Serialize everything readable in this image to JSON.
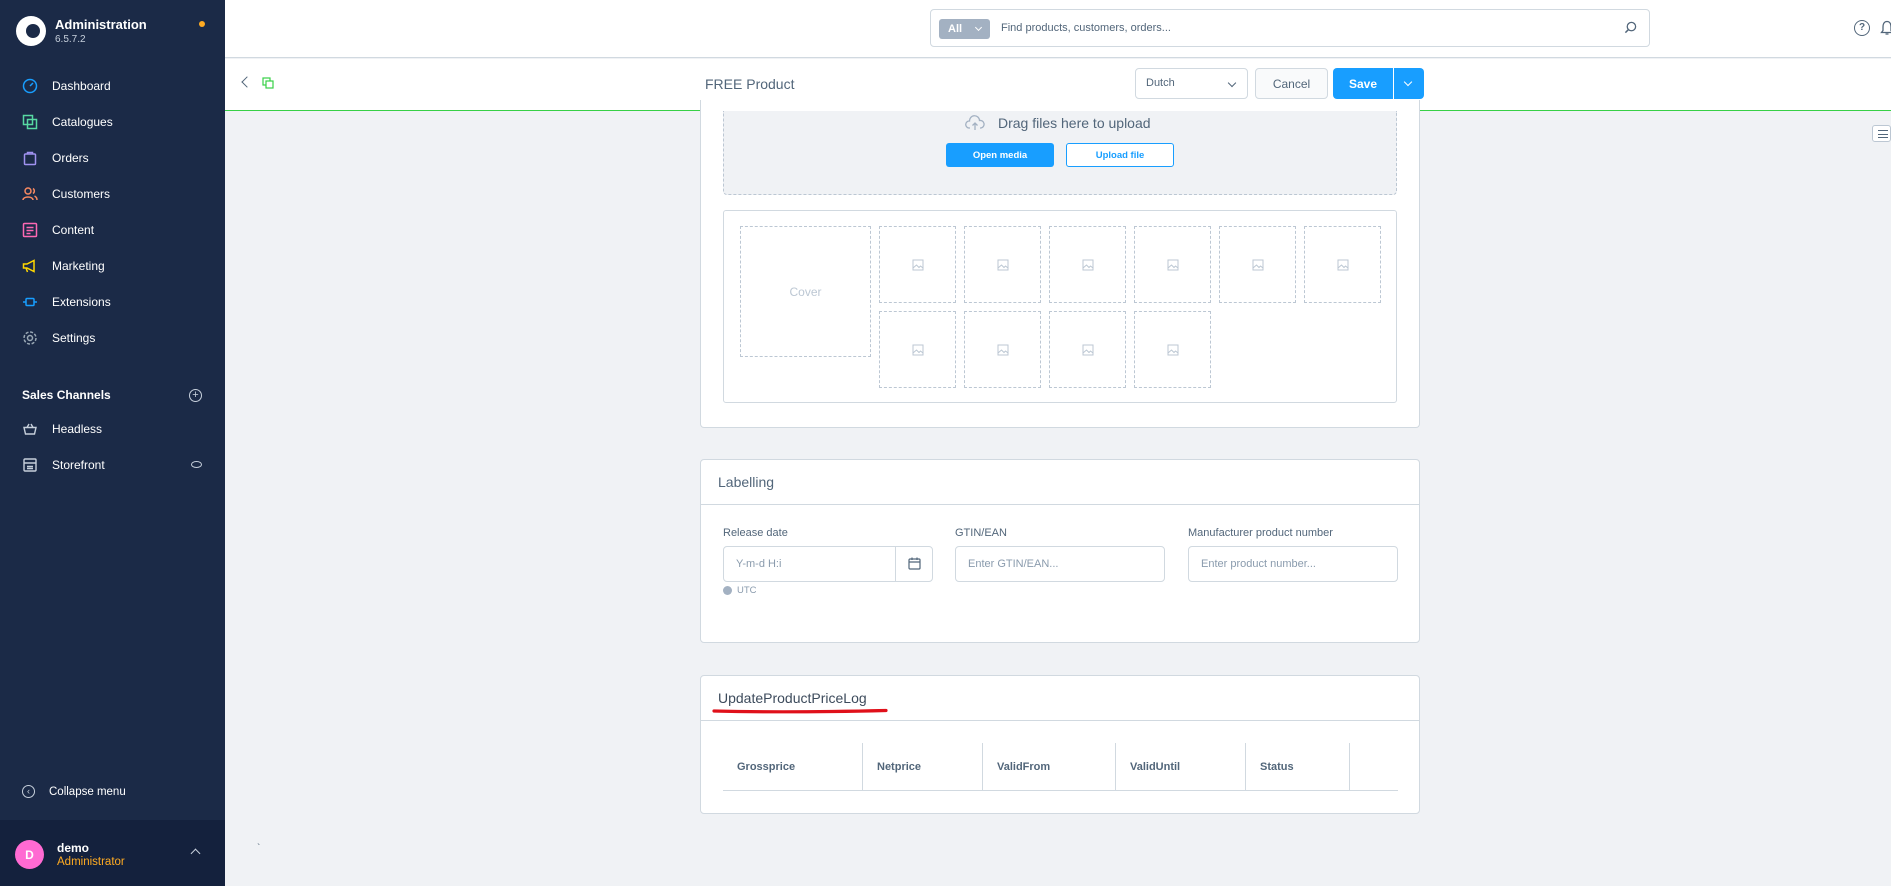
{
  "app": {
    "title": "Administration",
    "version": "6.5.7.2"
  },
  "sidebar": {
    "items": [
      {
        "label": "Dashboard",
        "icon": "dashboard-icon",
        "color": "#189eff"
      },
      {
        "label": "Catalogues",
        "icon": "catalogues-icon",
        "color": "#57d9a3"
      },
      {
        "label": "Orders",
        "icon": "orders-icon",
        "color": "#a092f0"
      },
      {
        "label": "Customers",
        "icon": "customers-icon",
        "color": "#f88962"
      },
      {
        "label": "Content",
        "icon": "content-icon",
        "color": "#ff68b4"
      },
      {
        "label": "Marketing",
        "icon": "marketing-icon",
        "color": "#ffd700"
      },
      {
        "label": "Extensions",
        "icon": "extensions-icon",
        "color": "#189eff"
      },
      {
        "label": "Settings",
        "icon": "settings-icon",
        "color": "#9aa8b5"
      }
    ],
    "sales_channels": {
      "title": "Sales Channels",
      "items": [
        {
          "label": "Headless",
          "icon": "basket-icon"
        },
        {
          "label": "Storefront",
          "icon": "storefront-icon"
        }
      ]
    },
    "collapse_label": "Collapse menu",
    "user": {
      "initial": "D",
      "name": "demo",
      "role": "Administrator"
    }
  },
  "search": {
    "scope": "All",
    "placeholder": "Find products, customers, orders..."
  },
  "smartbar": {
    "title": "FREE Product",
    "language": "Dutch",
    "cancel_label": "Cancel",
    "save_label": "Save"
  },
  "media": {
    "drop_text": "Drag files here to upload",
    "open_media_label": "Open media",
    "upload_file_label": "Upload file",
    "cover_label": "Cover"
  },
  "labelling": {
    "title": "Labelling",
    "release_date_label": "Release date",
    "release_date_placeholder": "Y-m-d H:i",
    "timezone": "UTC",
    "gtin_label": "GTIN/EAN",
    "gtin_placeholder": "Enter GTIN/EAN...",
    "mpn_label": "Manufacturer product number",
    "mpn_placeholder": "Enter product number..."
  },
  "price_log": {
    "title": "UpdateProductPriceLog",
    "columns": [
      "Grossprice",
      "Netprice",
      "ValidFrom",
      "ValidUntil",
      "Status"
    ]
  },
  "colors": {
    "sidebar_bg": "#1b2a47",
    "accent": "#189eff",
    "annotation": "#e0101a"
  }
}
